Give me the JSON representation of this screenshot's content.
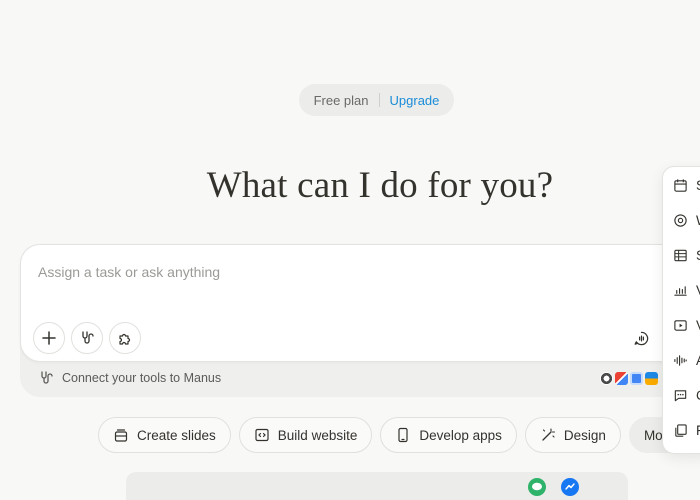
{
  "plan": {
    "label": "Free plan",
    "upgrade": "Upgrade"
  },
  "headline": "What can I do for you?",
  "composer": {
    "placeholder": "Assign a task or ask anything",
    "connect_label": "Connect your tools to Manus"
  },
  "chips": [
    {
      "label": "Create slides",
      "icon": "slides-icon"
    },
    {
      "label": "Build website",
      "icon": "code-window-icon"
    },
    {
      "label": "Develop apps",
      "icon": "phone-icon"
    },
    {
      "label": "Design",
      "icon": "magic-wand-icon"
    },
    {
      "label": "More"
    }
  ],
  "side_menu": [
    {
      "initial": "S",
      "icon": "calendar-icon"
    },
    {
      "initial": "W",
      "icon": "globe-icon"
    },
    {
      "initial": "S",
      "icon": "table-icon"
    },
    {
      "initial": "V",
      "icon": "chart-icon"
    },
    {
      "initial": "V",
      "icon": "video-icon"
    },
    {
      "initial": "A",
      "icon": "audio-wave-icon"
    },
    {
      "initial": "C",
      "icon": "chat-icon"
    },
    {
      "initial": "F",
      "icon": "copy-icon"
    }
  ],
  "colors": {
    "accent": "#1a8cd8",
    "background": "#f8f8f7",
    "text": "#34322d"
  }
}
